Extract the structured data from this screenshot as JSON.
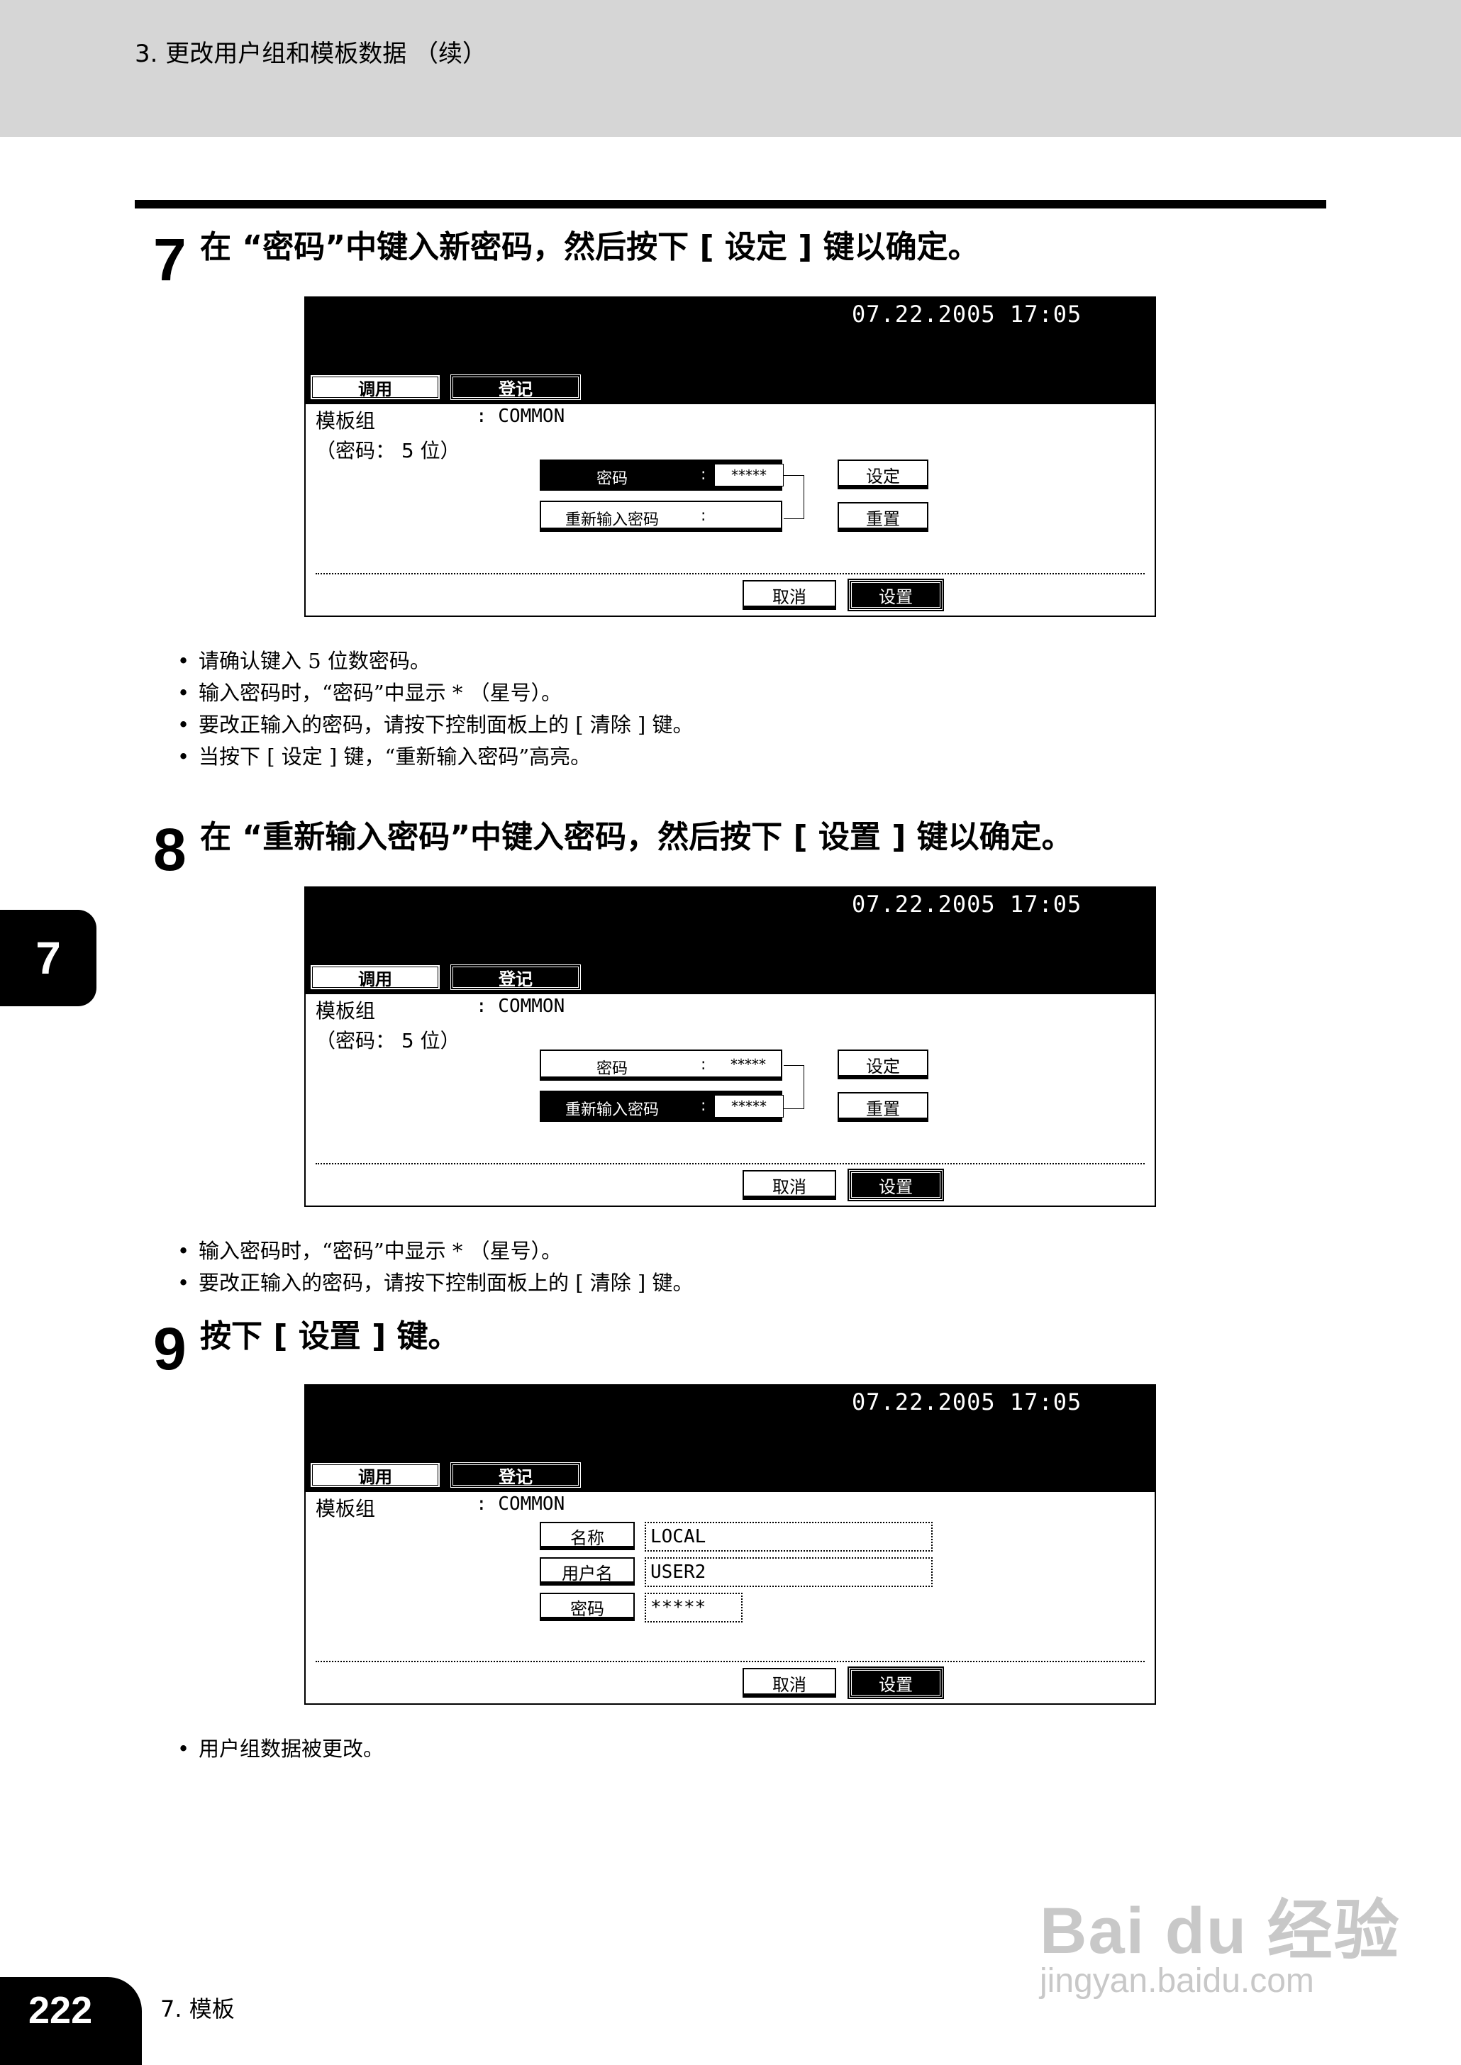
{
  "header": {
    "breadcrumb": "3. 更改用户组和模板数据  （续）"
  },
  "steps": [
    {
      "num": "7",
      "text": "在 “密码”中键入新密码，然后按下 [ 设定 ] 键以确定。",
      "screen": {
        "datetime": "07.22.2005 17:05",
        "tab_recall": "调用",
        "tab_register": "登记",
        "group_label": "模板组",
        "group_value": ": COMMON",
        "pw_note": "（密码： 5 位）",
        "pw_label": "密码",
        "pw_value": "*****",
        "repw_label": "重新输入密码",
        "repw_value": "",
        "set_btn": "设定",
        "reset_btn": "重置",
        "cancel_btn": "取消",
        "save_btn": "设置"
      },
      "notes": [
        "请确认键入 5 位数密码。",
        "输入密码时，“密码”中显示 * （星号）。",
        "要改正输入的密码，请按下控制面板上的 [ 清除 ] 键。",
        "当按下 [ 设定 ] 键，“重新输入密码”高亮。"
      ]
    },
    {
      "num": "8",
      "text": "在 “重新输入密码”中键入密码，然后按下 [ 设置 ] 键以确定。",
      "screen": {
        "datetime": "07.22.2005 17:05",
        "tab_recall": "调用",
        "tab_register": "登记",
        "group_label": "模板组",
        "group_value": ": COMMON",
        "pw_note": "（密码： 5 位）",
        "pw_label": "密码",
        "pw_value": "*****",
        "repw_label": "重新输入密码",
        "repw_value": "*****",
        "set_btn": "设定",
        "reset_btn": "重置",
        "cancel_btn": "取消",
        "save_btn": "设置"
      },
      "notes": [
        "输入密码时，“密码”中显示 * （星号）。",
        "要改正输入的密码，请按下控制面板上的 [ 清除 ] 键。"
      ]
    },
    {
      "num": "9",
      "text": "按下 [ 设置 ] 键。",
      "screen": {
        "datetime": "07.22.2005 17:05",
        "tab_recall": "调用",
        "tab_register": "登记",
        "group_label": "模板组",
        "group_value": ": COMMON",
        "name_label": "名称",
        "name_value": "LOCAL",
        "user_label": "用户名",
        "user_value": "USER2",
        "pw_label": "密码",
        "pw_value": "*****",
        "cancel_btn": "取消",
        "save_btn": "设置"
      },
      "notes": [
        "用户组数据被更改。"
      ]
    }
  ],
  "chapter_tab": "7",
  "footer": {
    "page_number": "222",
    "chapter_title": "7. 模板"
  },
  "watermark": {
    "line1": "Bai du 经验",
    "line2": "jingyan.baidu.com"
  }
}
